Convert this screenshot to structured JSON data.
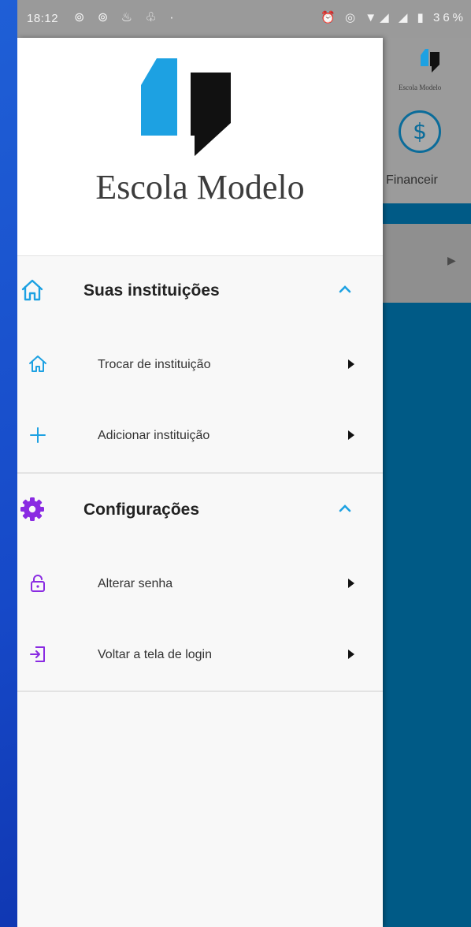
{
  "status_bar": {
    "time": "18:12",
    "notification_icons": "⊚ ⊚ ♨ ♧ ·",
    "system_icons": "⏰ ◎ ▼◢ ◢ ▮ 36%"
  },
  "drawer": {
    "brand_name": "Escola Modelo",
    "colors": {
      "accent_blue": "#1da1e2",
      "purple": "#8a2be2",
      "dark": "#111111"
    },
    "sections": [
      {
        "title": "Suas instituições",
        "icon": "home-icon",
        "expanded": true,
        "items": [
          {
            "label": "Trocar de instituição",
            "icon": "home-icon"
          },
          {
            "label": "Adicionar instituição",
            "icon": "plus-icon"
          }
        ]
      },
      {
        "title": "Configurações",
        "icon": "gear-icon",
        "expanded": true,
        "items": [
          {
            "label": "Alterar senha",
            "icon": "lock-icon"
          },
          {
            "label": "Voltar a tela de login",
            "icon": "login-icon"
          }
        ]
      }
    ]
  },
  "background_app": {
    "brand_name": "Escola Modelo",
    "financial_label": "Financeir",
    "financial_icon": "dollar-icon"
  }
}
